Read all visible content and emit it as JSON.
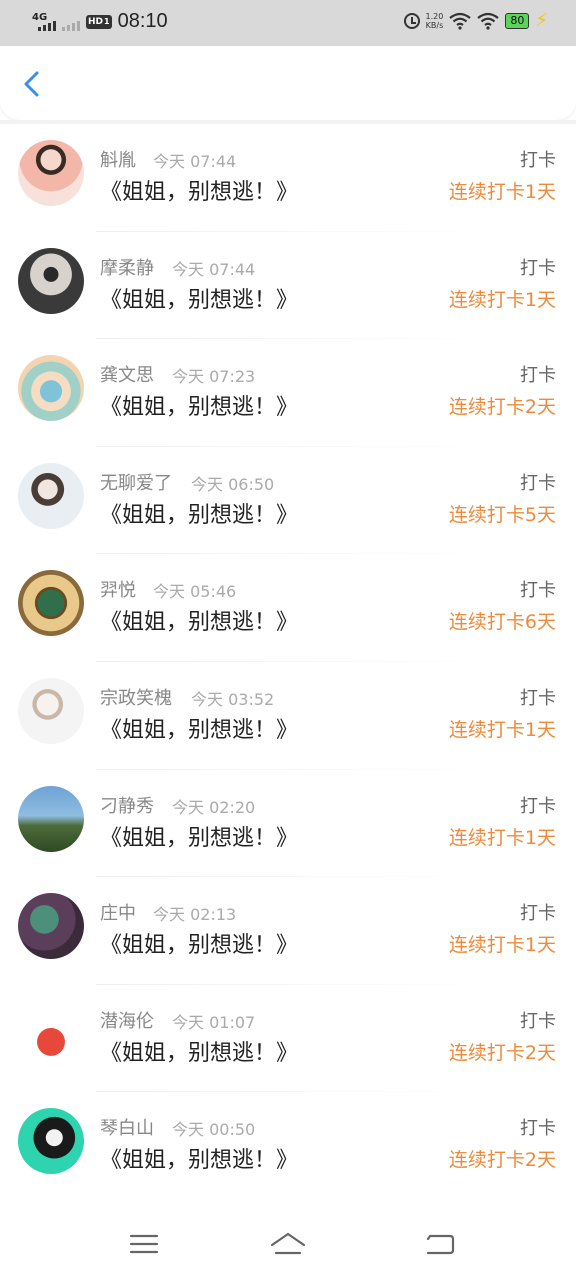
{
  "status_bar": {
    "network": "4G",
    "hd": "HD",
    "hd_sub": "1",
    "time": "08:10",
    "speed_value": "1.20",
    "speed_unit": "KB/s",
    "battery": "80"
  },
  "header": {
    "back_icon": "chevron-left-icon"
  },
  "colors": {
    "accent_blue": "#3b8ee6",
    "streak_orange": "#ef8a3a"
  },
  "entries": [
    {
      "name": "斛胤",
      "time": "今天 07:44",
      "title": "《姐姐，别想逃！》",
      "action": "打卡",
      "streak": "连续打卡1天"
    },
    {
      "name": "摩柔静",
      "time": "今天 07:44",
      "title": "《姐姐，别想逃！》",
      "action": "打卡",
      "streak": "连续打卡1天"
    },
    {
      "name": "龚文思",
      "time": "今天 07:23",
      "title": "《姐姐，别想逃！》",
      "action": "打卡",
      "streak": "连续打卡2天"
    },
    {
      "name": "无聊爱了",
      "time": "今天 06:50",
      "title": "《姐姐，别想逃！》",
      "action": "打卡",
      "streak": "连续打卡5天"
    },
    {
      "name": "羿悦",
      "time": "今天 05:46",
      "title": "《姐姐，别想逃！》",
      "action": "打卡",
      "streak": "连续打卡6天"
    },
    {
      "name": "宗政笑槐",
      "time": "今天 03:52",
      "title": "《姐姐，别想逃！》",
      "action": "打卡",
      "streak": "连续打卡1天"
    },
    {
      "name": "刁静秀",
      "time": "今天 02:20",
      "title": "《姐姐，别想逃！》",
      "action": "打卡",
      "streak": "连续打卡1天"
    },
    {
      "name": "庄中",
      "time": "今天 02:13",
      "title": "《姐姐，别想逃！》",
      "action": "打卡",
      "streak": "连续打卡1天"
    },
    {
      "name": "潜海伦",
      "time": "今天 01:07",
      "title": "《姐姐，别想逃！》",
      "action": "打卡",
      "streak": "连续打卡2天"
    },
    {
      "name": "琴白山",
      "time": "今天 00:50",
      "title": "《姐姐，别想逃！》",
      "action": "打卡",
      "streak": "连续打卡2天"
    }
  ],
  "nav": {
    "menu_icon": "menu-icon",
    "home_icon": "home-icon",
    "back_icon": "back-arrow-icon"
  }
}
